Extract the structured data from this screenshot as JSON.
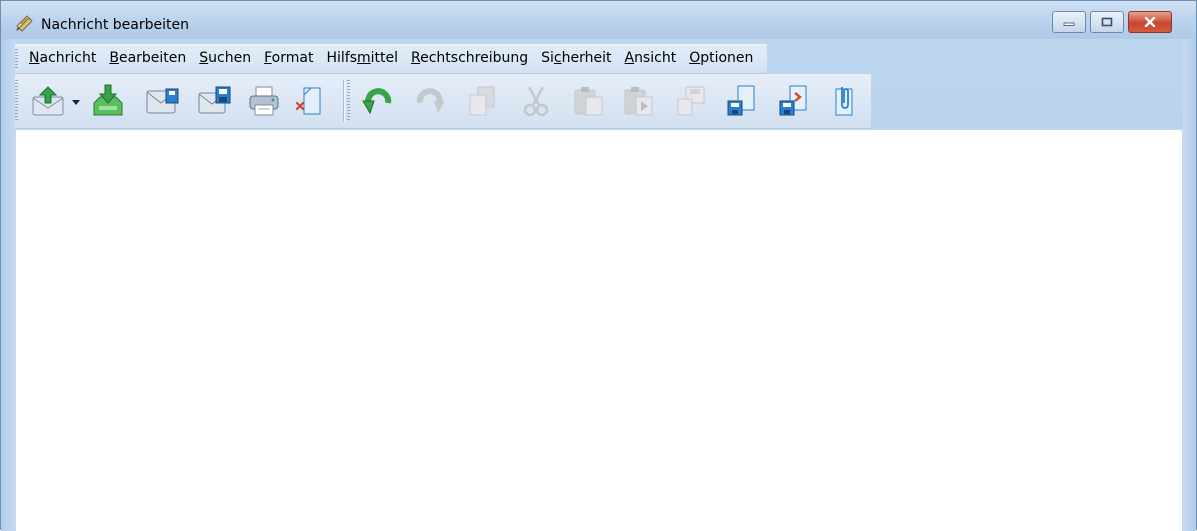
{
  "window": {
    "title": "Nachricht bearbeiten",
    "icon": "edit-message-icon",
    "controls": [
      "minimize-icon",
      "maximize-icon",
      "close-icon"
    ]
  },
  "menu": [
    {
      "label": "Nachricht",
      "accel": "N",
      "rest": "achricht"
    },
    {
      "label": "Bearbeiten",
      "accel": "B",
      "rest": "earbeiten"
    },
    {
      "label": "Suchen",
      "accel": "S",
      "rest": "uchen"
    },
    {
      "label": "Format",
      "accel": "F",
      "rest": "ormat"
    },
    {
      "label": "Hilfsmittel",
      "pre": "Hilfs",
      "accel": "m",
      "rest": "ittel"
    },
    {
      "label": "Rechtschreibung",
      "accel": "R",
      "rest": "echtschreibung"
    },
    {
      "label": "Sicherheit",
      "pre": "Si",
      "accel": "c",
      "rest": "herheit"
    },
    {
      "label": "Ansicht",
      "accel": "A",
      "rest": "nsicht"
    },
    {
      "label": "Optionen",
      "accel": "O",
      "rest": "ptionen"
    }
  ],
  "toolbar": {
    "buttons": [
      {
        "icon": "send-icon",
        "enabled": true,
        "has_dropdown": true
      },
      {
        "icon": "save-to-outbox-icon",
        "enabled": true
      },
      {
        "icon": "save-draft-icon",
        "enabled": true
      },
      {
        "icon": "save-template-icon",
        "enabled": true
      },
      {
        "icon": "print-icon",
        "enabled": true
      },
      {
        "icon": "discard-icon",
        "enabled": true
      },
      {
        "icon": "undo-icon",
        "enabled": true
      },
      {
        "icon": "redo-icon",
        "enabled": false
      },
      {
        "icon": "copy-icon",
        "enabled": false
      },
      {
        "icon": "cut-icon",
        "enabled": false
      },
      {
        "icon": "paste-icon",
        "enabled": false
      },
      {
        "icon": "paste-special-icon",
        "enabled": false
      },
      {
        "icon": "copy-to-disk-icon",
        "enabled": false
      },
      {
        "icon": "save-file-icon",
        "enabled": true
      },
      {
        "icon": "insert-file-icon",
        "enabled": true
      },
      {
        "icon": "attach-icon",
        "enabled": true
      }
    ]
  },
  "colors": {
    "frame": "#b9d1ec",
    "accent_blue": "#2a7fd0",
    "accent_green": "#3aa34a",
    "close_red": "#c8462f",
    "disabled_gray": "#c4c8cd"
  }
}
